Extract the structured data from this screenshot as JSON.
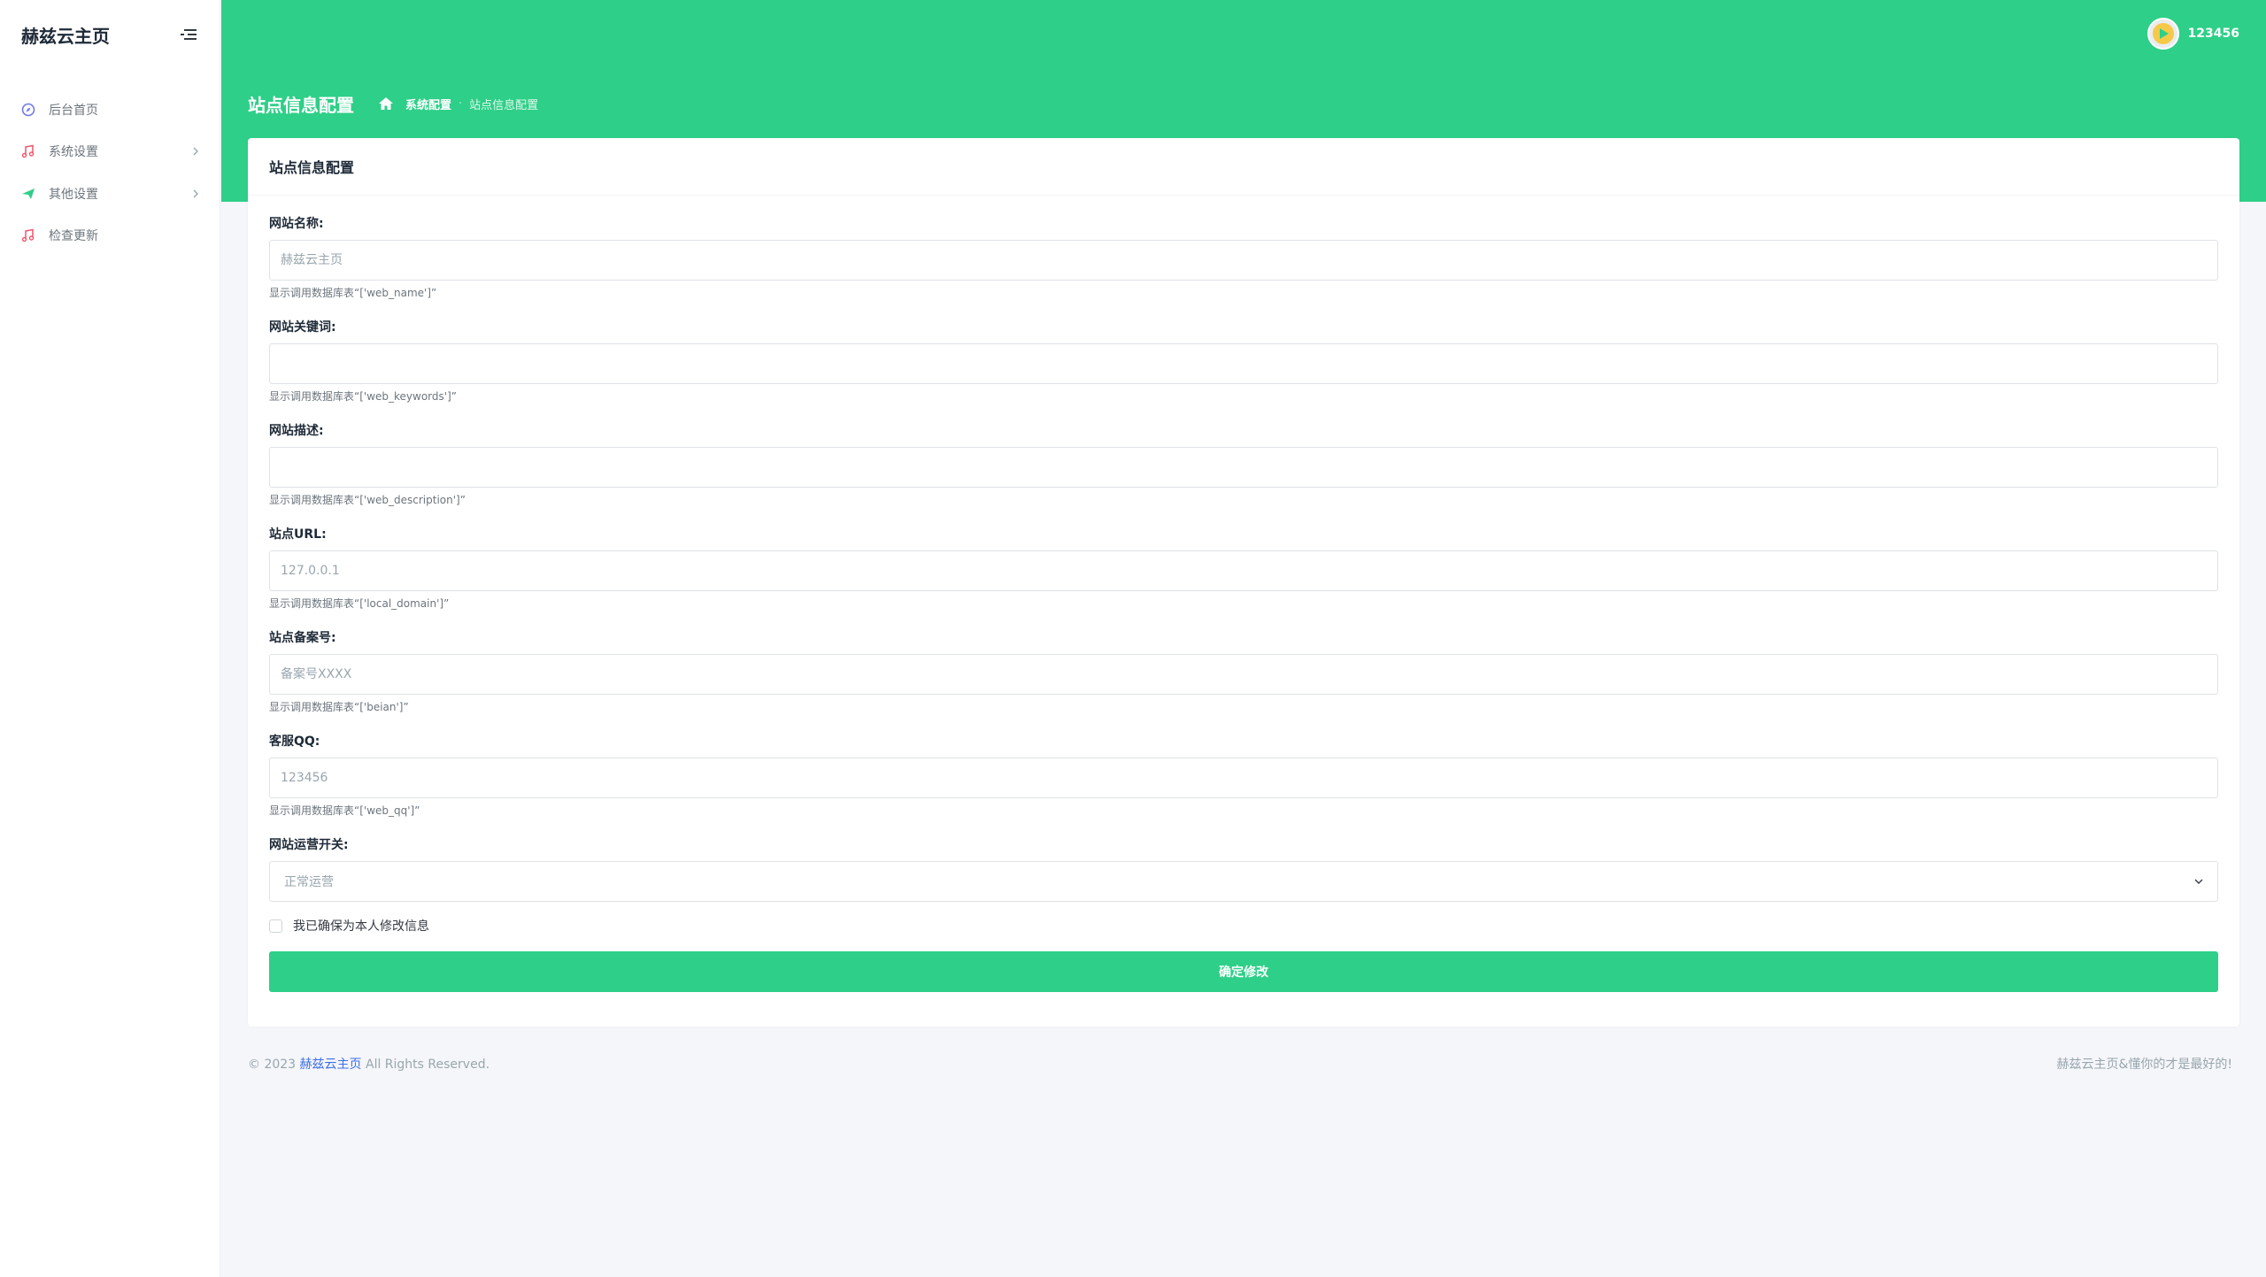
{
  "brand": {
    "title": "赫兹云主页"
  },
  "sidebar": {
    "items": [
      {
        "label": "后台首页",
        "icon": "dashboard-icon",
        "color": "#6f78e8",
        "has_chevron": false
      },
      {
        "label": "系统设置",
        "icon": "music-note-icon",
        "color": "#f1556c",
        "has_chevron": true
      },
      {
        "label": "其他设置",
        "icon": "paper-plane-icon",
        "color": "#2ecf88",
        "has_chevron": true
      },
      {
        "label": "检查更新",
        "icon": "music-note-icon",
        "color": "#f1556c",
        "has_chevron": false
      }
    ]
  },
  "topbar": {
    "username": "123456"
  },
  "header": {
    "page_title": "站点信息配置",
    "breadcrumb": {
      "parent": "系统配置",
      "current": "站点信息配置"
    }
  },
  "card": {
    "title": "站点信息配置",
    "fields": [
      {
        "label": "网站名称:",
        "placeholder": "赫兹云主页",
        "help": "显示调用数据库表“['web_name']”"
      },
      {
        "label": "网站关键词:",
        "placeholder": "",
        "help": "显示调用数据库表“['web_keywords']”"
      },
      {
        "label": "网站描述:",
        "placeholder": "",
        "help": "显示调用数据库表“['web_description']”"
      },
      {
        "label": "站点URL:",
        "placeholder": "127.0.0.1",
        "help": "显示调用数据库表“['local_domain']”"
      },
      {
        "label": "站点备案号:",
        "placeholder": "备案号XXXX",
        "help": "显示调用数据库表“['beian']”"
      },
      {
        "label": "客服QQ:",
        "placeholder": "123456",
        "help": "显示调用数据库表“['web_qq']”"
      }
    ],
    "select": {
      "label": "网站运营开关:",
      "value": "正常运营"
    },
    "checkbox_label": "我已确保为本人修改信息",
    "submit_label": "确定修改"
  },
  "footer": {
    "copyright_prefix": "© 2023",
    "brand_link": "赫兹云主页",
    "copyright_suffix": "All Rights Reserved.",
    "right_text": "赫兹云主页&懂你的才是最好的!"
  },
  "colors": {
    "accent": "#2ecf88",
    "link": "#3b6ee8"
  }
}
